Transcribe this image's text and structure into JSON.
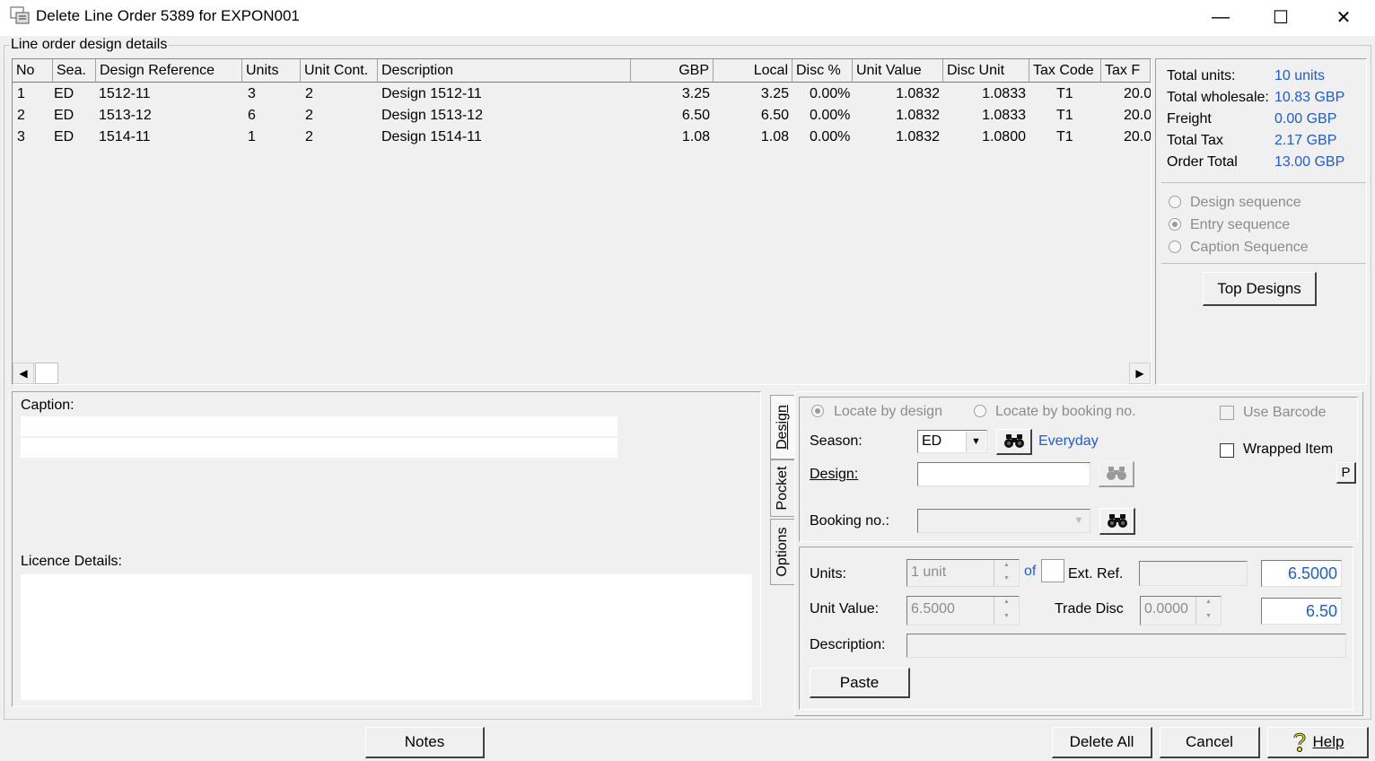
{
  "window": {
    "title": "Delete Line Order 5389 for EXPON001",
    "minimize": "—",
    "maximize": "☐",
    "close": "✕"
  },
  "group_title": "Line order design details",
  "table": {
    "headers": [
      "No",
      "Sea.",
      "Design Reference",
      "Units",
      "Unit Cont.",
      "Description",
      "GBP",
      "Local",
      "Disc %",
      "Unit Value",
      "Disc Unit",
      "Tax Code",
      "Tax F"
    ],
    "rows": [
      [
        "1",
        "ED",
        "1512-11",
        "3",
        "2",
        "Design 1512-11",
        "3.25",
        "3.25",
        "0.00%",
        "1.0832",
        "1.0833",
        "T1",
        "20.0"
      ],
      [
        "2",
        "ED",
        "1513-12",
        "6",
        "2",
        "Design 1513-12",
        "6.50",
        "6.50",
        "0.00%",
        "1.0832",
        "1.0833",
        "T1",
        "20.0"
      ],
      [
        "3",
        "ED",
        "1514-11",
        "1",
        "2",
        "Design 1514-11",
        "1.08",
        "1.08",
        "0.00%",
        "1.0832",
        "1.0800",
        "T1",
        "20.0"
      ]
    ]
  },
  "totals": {
    "units_label": "Total units:",
    "units_value": "10 units",
    "wholesale_label": "Total wholesale:",
    "wholesale_value": "10.83 GBP",
    "freight_label": "Freight",
    "freight_value": "0.00 GBP",
    "tax_label": "Total Tax",
    "tax_value": "2.17 GBP",
    "order_label": "Order Total",
    "order_value": "13.00 GBP"
  },
  "sequence": {
    "design": "Design sequence",
    "entry": "Entry sequence",
    "caption": "Caption Sequence",
    "selected": "entry"
  },
  "top_designs_button": "Top Designs",
  "caption_label": "Caption:",
  "licence_label": "Licence Details:",
  "tabs": [
    "Design",
    "Pocket",
    "Options"
  ],
  "locate": {
    "by_design": "Locate by design",
    "by_booking": "Locate by booking no.",
    "use_barcode": "Use Barcode",
    "wrapped_item": "Wrapped Item",
    "p_button": "P"
  },
  "season": {
    "label": "Season:",
    "value": "ED",
    "name": "Everyday"
  },
  "design_label": "Design:",
  "booking_label": "Booking no.:",
  "units": {
    "label": "Units:",
    "value": "1 unit",
    "of": "of",
    "ext_ref": "Ext. Ref.",
    "total": "6.5000"
  },
  "unit_value": {
    "label": "Unit Value:",
    "value": "6.5000",
    "trade_disc_label": "Trade Disc",
    "trade_disc_value": "0.0000",
    "total": "6.50"
  },
  "description_label": "Description:",
  "paste_button": "Paste",
  "footer": {
    "notes": "Notes",
    "delete_all": "Delete All",
    "cancel": "Cancel",
    "help": "Help"
  }
}
